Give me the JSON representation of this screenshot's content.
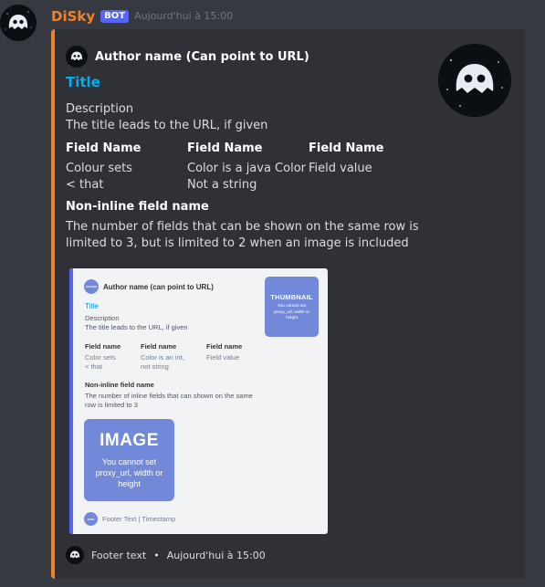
{
  "message": {
    "username": "DiSky",
    "bot_tag": "BOT",
    "timestamp": "Aujourd'hui à 15:00",
    "avatar_icon": "ghost-avatar-icon"
  },
  "embed": {
    "color": "#f0832a",
    "author": {
      "name": "Author name (Can point to URL)",
      "icon": "ghost-avatar-icon"
    },
    "title": "Title",
    "title_color": "#00b0f4",
    "description": {
      "line1": "Description",
      "line2": "The title leads to the URL, if given"
    },
    "fields": [
      {
        "name": "Field Name",
        "value_line1": "Colour sets",
        "value_line2": "< that"
      },
      {
        "name": "Field Name",
        "value_line1": "Color is a java Color",
        "value_line2": "Not a string"
      },
      {
        "name": "Field Name",
        "value_line1": "Field value",
        "value_line2": ""
      }
    ],
    "non_inline": {
      "name": "Non-inline field name",
      "value": "The number of fields that can be shown on the same row is limited to 3, but is limited to 2 when an image is included"
    },
    "thumbnail_icon": "ghost-avatar-icon",
    "footer": {
      "text": "Footer text",
      "separator": "•",
      "timestamp": "Aujourd'hui à 15:00",
      "icon": "ghost-avatar-icon"
    }
  },
  "embed_image": {
    "bar_color": "#5865f2",
    "accent_color": "#7289da",
    "author_icon_label": "AUTHOR",
    "author_name": "Author name (can point to URL)",
    "title": "Title",
    "description_line1": "Description",
    "description_line2": "The title leads to the URL, if given",
    "fields": [
      {
        "name": "Field name",
        "value_line1": "Color sets",
        "value_line2": "< that"
      },
      {
        "name": "Field name",
        "value_line1": "Color is an int,",
        "value_line2": "not string"
      },
      {
        "name": "Field name",
        "value_line1": "Field value",
        "value_line2": ""
      }
    ],
    "non_inline_name": "Non-inline field name",
    "non_inline_value": "The number of inline fields that can shown on the same row is limited to 3",
    "thumbnail": {
      "title": "THUMBNAIL",
      "subtitle": "You cannot set proxy_url, width or height"
    },
    "image": {
      "title": "IMAGE",
      "subtitle": "You cannot set proxy_url, width or height"
    },
    "footer_icon_label": "ICON",
    "footer_text": "Footer Text | Timestamp"
  }
}
